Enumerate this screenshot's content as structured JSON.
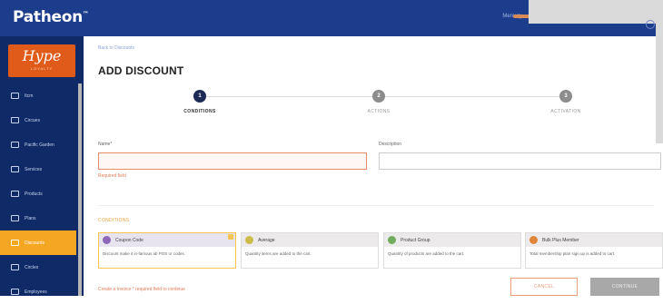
{
  "header": {
    "brand": "Patheon",
    "links": "Mercury",
    "colors": {
      "bar": "#1c3c8c",
      "accent": "#e05a1a"
    }
  },
  "sidebar": {
    "logo_main": "Hype",
    "logo_sub": "LOYALTY",
    "items": [
      {
        "label": "Itcm",
        "icon": "home-icon"
      },
      {
        "label": "Circues",
        "icon": "list-icon"
      },
      {
        "label": "Pacific Garden",
        "icon": "tag-icon"
      },
      {
        "label": "Services",
        "icon": "people-icon"
      },
      {
        "label": "Products",
        "icon": "box-icon"
      },
      {
        "label": "Plans",
        "icon": "grid-icon"
      },
      {
        "label": "Discounts",
        "icon": "discount-icon",
        "active": true
      },
      {
        "label": "Circles",
        "icon": "chart-icon"
      },
      {
        "label": "Employees",
        "icon": "user-icon"
      }
    ]
  },
  "main": {
    "breadcrumb": "Back to Discounts",
    "title": "ADD DISCOUNT",
    "steps": [
      {
        "number": "1",
        "label": "CONDITIONS",
        "state": "current"
      },
      {
        "number": "2",
        "label": "ACTIONS",
        "state": "pending"
      },
      {
        "number": "3",
        "label": "ACTIVATION",
        "state": "pending"
      }
    ],
    "form": {
      "name_label": "Name*",
      "name_value": "",
      "name_error": "Required field",
      "description_label": "Description",
      "description_value": ""
    },
    "section_label": "CONDITIONS",
    "cards": [
      {
        "title": "Coupon Code",
        "description": "Discount make it in-famous ab POS or codes.",
        "selected": true,
        "color": "#8e67b8"
      },
      {
        "title": "Average",
        "description": "Quantity items are added to the cart.",
        "selected": false,
        "color": "#cdbb4a"
      },
      {
        "title": "Product Group",
        "description": "Quantity of products are added to the cart.",
        "selected": false,
        "color": "#6fae5c"
      },
      {
        "title": "Bulk Plus Member",
        "description": "Total membership plan sign up is added to cart.",
        "selected": false,
        "color": "#e0863a"
      }
    ],
    "footer_note": "Create a Invoice * required field to continue",
    "buttons": {
      "cancel": "CANCEL",
      "continue": "CONTINUE"
    }
  }
}
